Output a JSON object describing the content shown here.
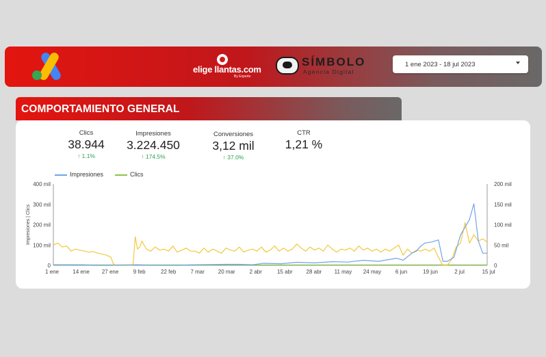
{
  "header": {
    "date_range": "1 ene 2023 - 18 jul 2023",
    "brand_eligellantas": "elige llantas.com",
    "brand_eligellantas_sub": "By Experto",
    "brand_simbolo": "SÍMBOLO",
    "brand_simbolo_tag": "Agencia Digital"
  },
  "section": {
    "title": "COMPORTAMIENTO GENERAL"
  },
  "kpis": [
    {
      "label": "Clics",
      "value": "38.944",
      "delta": "1.1%"
    },
    {
      "label": "Impresiones",
      "value": "3.224.450",
      "delta": "174.5%"
    },
    {
      "label": "Conversiones",
      "value": "3,12 mil",
      "delta": "37.0%"
    },
    {
      "label": "CTR",
      "value": "1,21 %",
      "delta": ""
    }
  ],
  "colors": {
    "impresiones": "#6fa3e8",
    "clics": "#8bc34a",
    "ctr_line": "#f2c83b",
    "header_red": "#e3150f",
    "delta_green": "#2e9e4f"
  },
  "chart_data": {
    "type": "line",
    "legend": [
      "Impresiones",
      "Clics"
    ],
    "legend_position": "top-left",
    "ylabel_left": "Impresiones | Clics",
    "ylim_left": [
      0,
      400
    ],
    "yticks_left": [
      "0",
      "100 mil",
      "200 mil",
      "300 mil",
      "400 mil"
    ],
    "ylim_right": [
      0,
      200
    ],
    "yticks_right": [
      "0",
      "50 mil",
      "100 mil",
      "150 mil",
      "200 mil"
    ],
    "xticks": [
      "1 ene",
      "14 ene",
      "27 ene",
      "9 feb",
      "22 feb",
      "7 mar",
      "20 mar",
      "2 abr",
      "15 abr",
      "28 abr",
      "11 may",
      "24 may",
      "6 jun",
      "19 jun",
      "2 jul",
      "15 jul"
    ],
    "grid": false,
    "series": [
      {
        "name": "Impresiones",
        "axis": "left",
        "points": [
          [
            0,
            3
          ],
          [
            13,
            3
          ],
          [
            18,
            0
          ],
          [
            26,
            0
          ],
          [
            38,
            3
          ],
          [
            44,
            0
          ],
          [
            57,
            0
          ],
          [
            64,
            3
          ],
          [
            70,
            4
          ],
          [
            78,
            5
          ],
          [
            84,
            5
          ],
          [
            90,
            3
          ],
          [
            95,
            10
          ],
          [
            103,
            8
          ],
          [
            110,
            15
          ],
          [
            118,
            12
          ],
          [
            126,
            18
          ],
          [
            133,
            16
          ],
          [
            140,
            25
          ],
          [
            147,
            20
          ],
          [
            155,
            35
          ],
          [
            158,
            25
          ],
          [
            162,
            60
          ],
          [
            164,
            70
          ],
          [
            166,
            95
          ],
          [
            168,
            110
          ],
          [
            171,
            115
          ],
          [
            174,
            125
          ],
          [
            176,
            20
          ],
          [
            178,
            20
          ],
          [
            181,
            40
          ],
          [
            184,
            150
          ],
          [
            188,
            225
          ],
          [
            190,
            303
          ],
          [
            192,
            120
          ],
          [
            194,
            60
          ],
          [
            196,
            60
          ]
        ]
      },
      {
        "name": "Clics",
        "axis": "right",
        "points": [
          [
            0,
            1
          ],
          [
            196,
            1
          ]
        ]
      },
      {
        "name": "CTR",
        "axis": "left",
        "points": [
          [
            0,
            100
          ],
          [
            2,
            110
          ],
          [
            4,
            90
          ],
          [
            6,
            95
          ],
          [
            8,
            70
          ],
          [
            10,
            80
          ],
          [
            12,
            75
          ],
          [
            14,
            70
          ],
          [
            16,
            65
          ],
          [
            18,
            68
          ],
          [
            20,
            60
          ],
          [
            22,
            55
          ],
          [
            24,
            50
          ],
          [
            26,
            40
          ],
          [
            27,
            10
          ],
          [
            28,
            0
          ],
          [
            36,
            0
          ],
          [
            37,
            140
          ],
          [
            38,
            80
          ],
          [
            39,
            90
          ],
          [
            40,
            120
          ],
          [
            41,
            100
          ],
          [
            42,
            80
          ],
          [
            44,
            70
          ],
          [
            46,
            90
          ],
          [
            48,
            75
          ],
          [
            50,
            80
          ],
          [
            52,
            70
          ],
          [
            54,
            95
          ],
          [
            56,
            65
          ],
          [
            58,
            75
          ],
          [
            60,
            85
          ],
          [
            62,
            70
          ],
          [
            64,
            70
          ],
          [
            66,
            60
          ],
          [
            68,
            85
          ],
          [
            70,
            65
          ],
          [
            72,
            80
          ],
          [
            74,
            70
          ],
          [
            76,
            60
          ],
          [
            78,
            85
          ],
          [
            80,
            75
          ],
          [
            82,
            70
          ],
          [
            84,
            90
          ],
          [
            86,
            65
          ],
          [
            88,
            75
          ],
          [
            90,
            80
          ],
          [
            92,
            70
          ],
          [
            94,
            90
          ],
          [
            96,
            65
          ],
          [
            98,
            75
          ],
          [
            100,
            95
          ],
          [
            102,
            70
          ],
          [
            104,
            85
          ],
          [
            106,
            70
          ],
          [
            108,
            80
          ],
          [
            110,
            105
          ],
          [
            112,
            85
          ],
          [
            114,
            70
          ],
          [
            116,
            90
          ],
          [
            118,
            75
          ],
          [
            120,
            85
          ],
          [
            122,
            70
          ],
          [
            124,
            100
          ],
          [
            126,
            80
          ],
          [
            128,
            65
          ],
          [
            130,
            80
          ],
          [
            132,
            75
          ],
          [
            134,
            85
          ],
          [
            136,
            70
          ],
          [
            138,
            95
          ],
          [
            140,
            75
          ],
          [
            142,
            85
          ],
          [
            144,
            70
          ],
          [
            146,
            80
          ],
          [
            148,
            65
          ],
          [
            150,
            80
          ],
          [
            152,
            70
          ],
          [
            154,
            85
          ],
          [
            156,
            100
          ],
          [
            158,
            50
          ],
          [
            160,
            80
          ],
          [
            162,
            60
          ],
          [
            164,
            75
          ],
          [
            166,
            70
          ],
          [
            168,
            80
          ],
          [
            170,
            70
          ],
          [
            172,
            85
          ],
          [
            174,
            40
          ],
          [
            176,
            0
          ],
          [
            178,
            0
          ],
          [
            180,
            30
          ],
          [
            182,
            90
          ],
          [
            184,
            110
          ],
          [
            186,
            210
          ],
          [
            188,
            110
          ],
          [
            190,
            150
          ],
          [
            192,
            120
          ],
          [
            194,
            130
          ],
          [
            196,
            115
          ]
        ]
      }
    ]
  }
}
